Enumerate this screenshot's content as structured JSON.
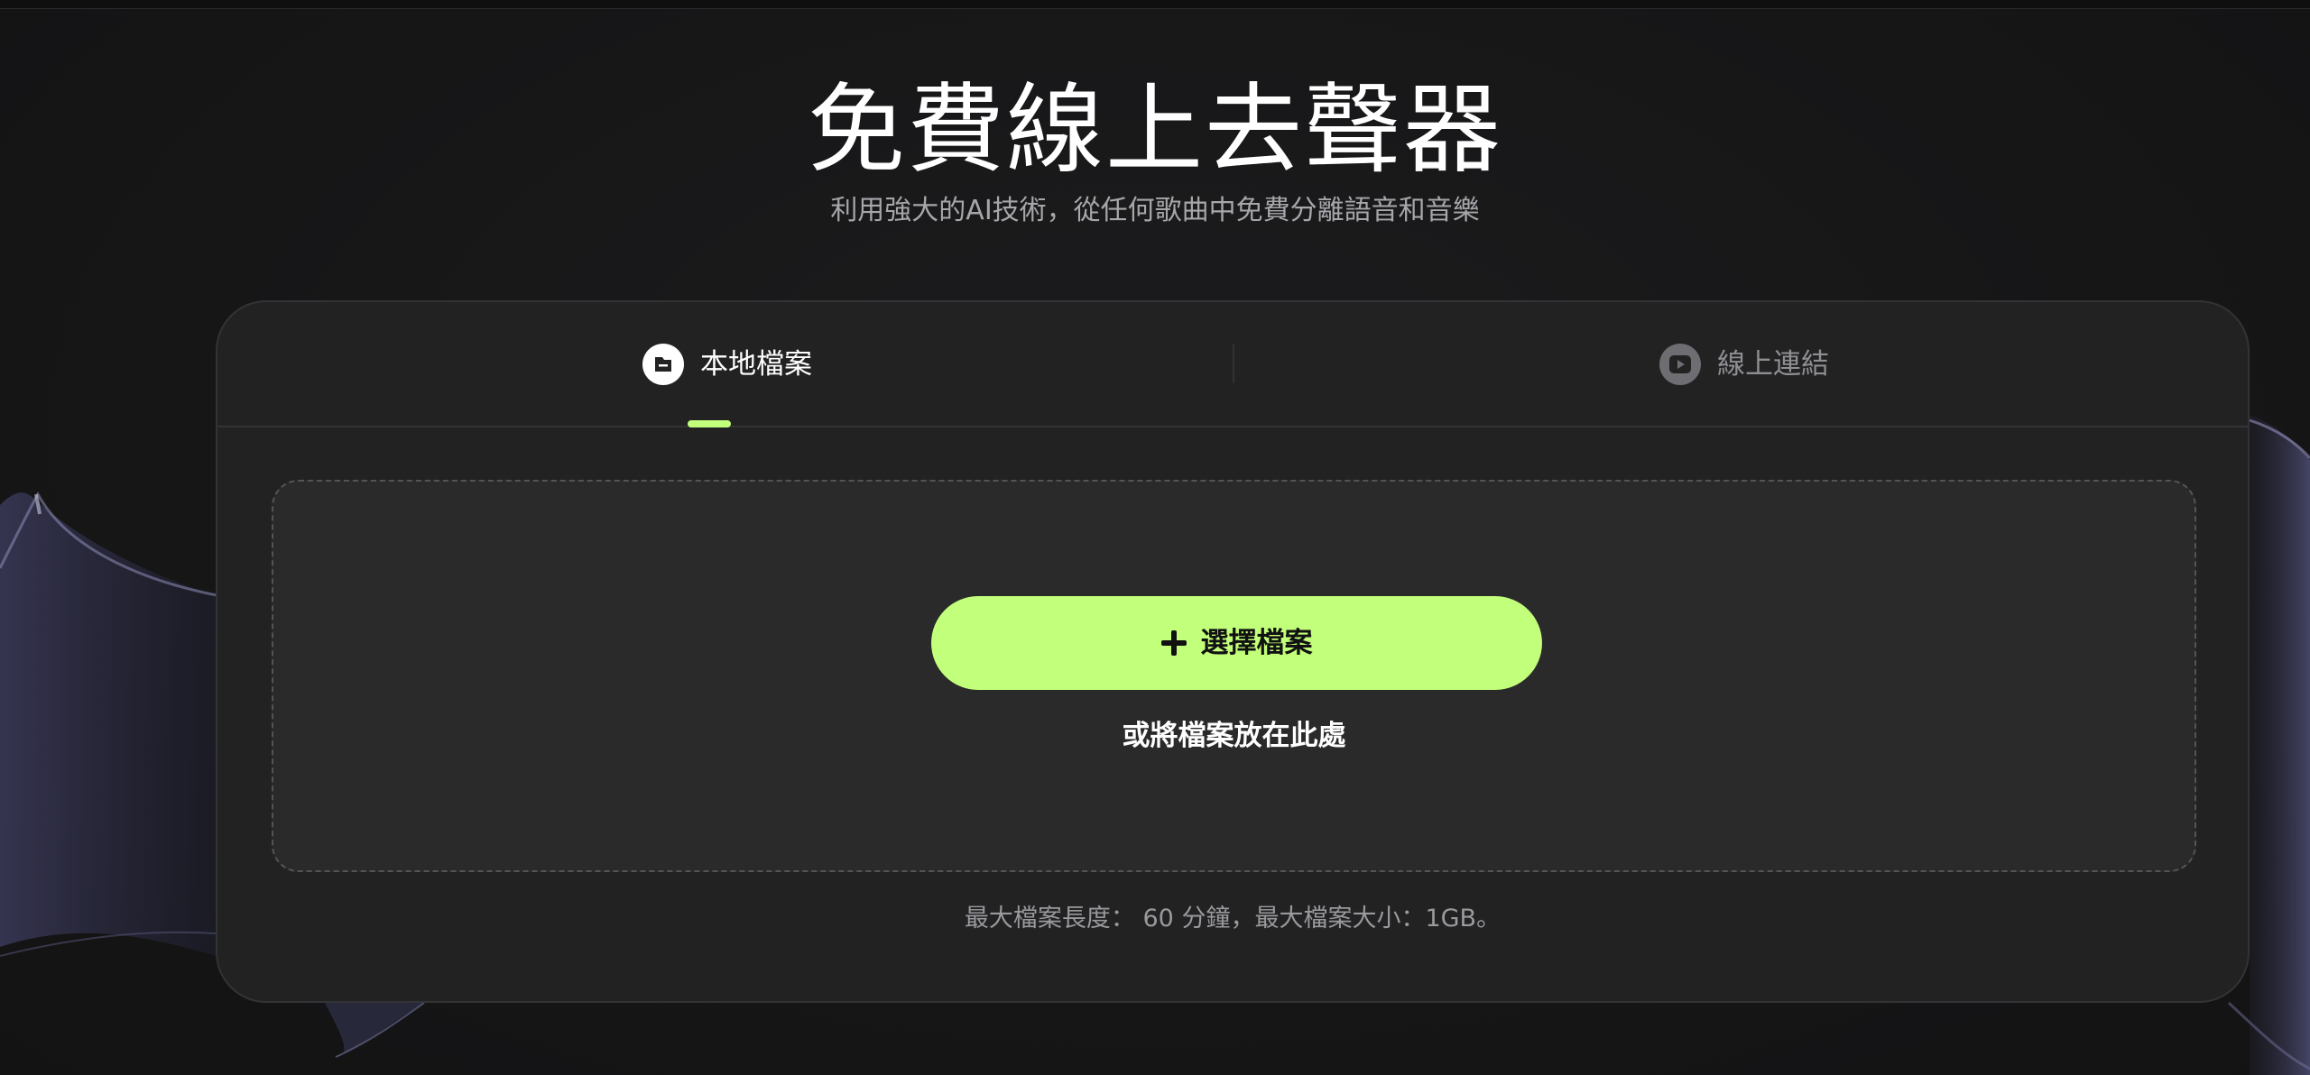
{
  "hero": {
    "title": "免費線上去聲器",
    "subtitle": "利用強大的AI技術，從任何歌曲中免費分離語音和音樂"
  },
  "tabs": [
    {
      "label": "本地檔案",
      "icon": "file-icon",
      "active": true
    },
    {
      "label": "線上連結",
      "icon": "youtube-play-icon",
      "active": false
    }
  ],
  "upload": {
    "button_label": "選擇檔案",
    "button_icon": "plus-icon",
    "drop_hint": "或將檔案放在此處"
  },
  "limits_text": "最大檔案長度： 60 分鐘，最大檔案大小：1GB。",
  "colors": {
    "accent": "#c2ff7a",
    "background": "#161617",
    "card": "#222223",
    "dropzone": "#2a2a2b"
  }
}
